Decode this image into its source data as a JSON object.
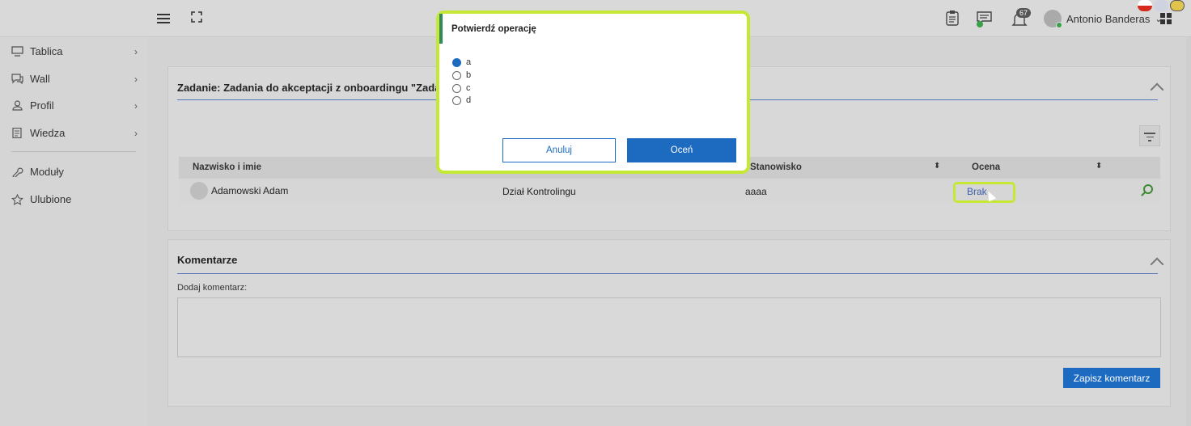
{
  "topbar": {
    "user_name": "Antonio Banderas",
    "user_caret": "⌄",
    "notifications_count": "67"
  },
  "sidebar": {
    "items": [
      {
        "label": "Tablica",
        "icon": "monitor-icon",
        "has_children": true
      },
      {
        "label": "Wall",
        "icon": "chat-icon",
        "has_children": true
      },
      {
        "label": "Profil",
        "icon": "user-icon",
        "has_children": true
      },
      {
        "label": "Wiedza",
        "icon": "document-icon",
        "has_children": true
      },
      {
        "label": "Moduły",
        "icon": "wrench-icon",
        "has_children": false
      },
      {
        "label": "Ulubione",
        "icon": "star-icon",
        "has_children": false
      }
    ],
    "chevron": "›"
  },
  "task_panel": {
    "title": "Zadanie: Zadania do akceptacji z onboardingu \"Zada",
    "table": {
      "headers": [
        "Nazwisko i imie",
        "Stanowisko",
        "Ocena"
      ],
      "sort_glyph": "⬍",
      "rows": [
        {
          "name": "Adamowski Adam",
          "department": "Dział Kontrolingu",
          "position": "aaaa",
          "rating": "Brak"
        }
      ]
    }
  },
  "comments_panel": {
    "title": "Komentarze",
    "add_label": "Dodaj komentarz:",
    "textarea_value": "",
    "save_label": "Zapisz komentarz"
  },
  "modal": {
    "title": "Potwierdź operację",
    "options": [
      {
        "label": "a",
        "selected": true
      },
      {
        "label": "b",
        "selected": false
      },
      {
        "label": "c",
        "selected": false
      },
      {
        "label": "d",
        "selected": false
      }
    ],
    "cancel_label": "Anuluj",
    "confirm_label": "Oceń"
  },
  "colors": {
    "primary": "#1d6bc0",
    "highlight": "#c4e833",
    "accent_green": "#2f8b5a"
  }
}
